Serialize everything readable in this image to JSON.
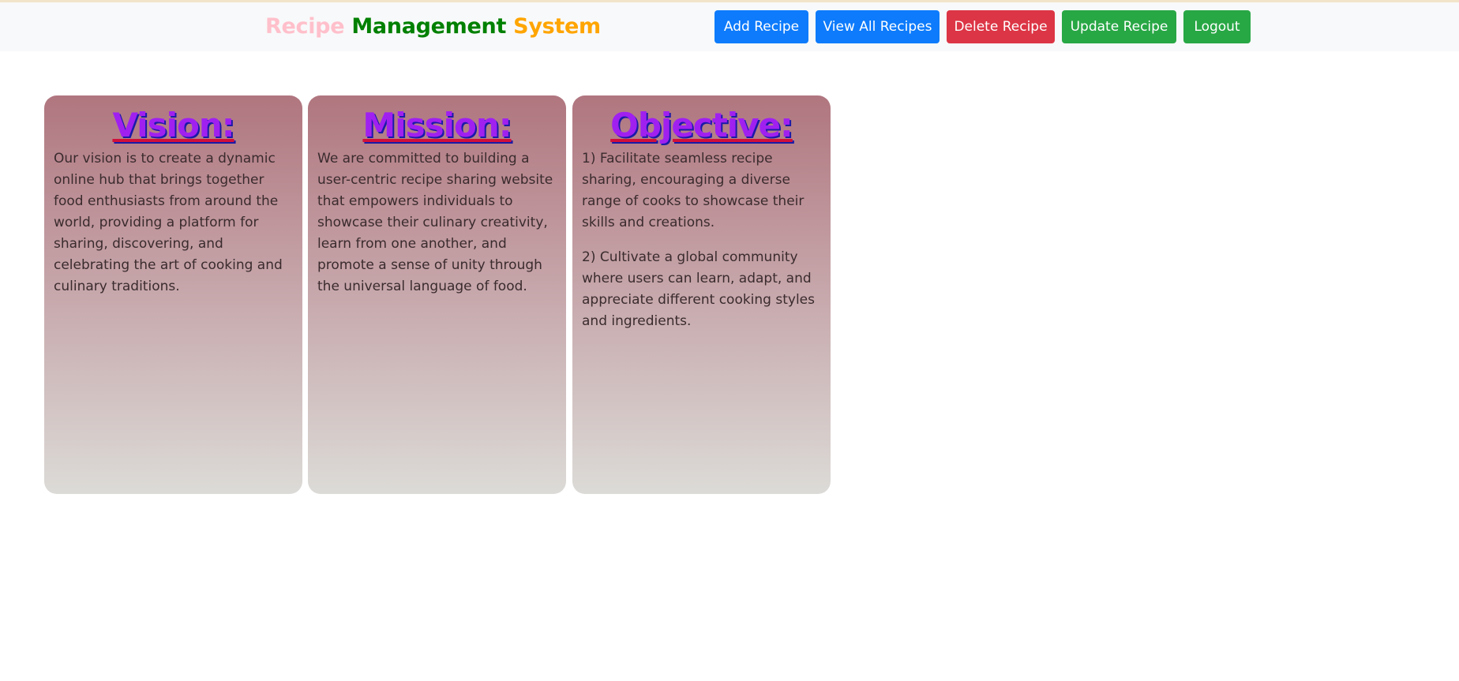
{
  "header": {
    "brand": {
      "word1": "Recipe",
      "word2": "Management",
      "word3": "System"
    },
    "buttons": {
      "add_recipe": "Add Recipe",
      "view_all_recipes": "View All Recipes",
      "delete_recipe": "Delete Recipe",
      "update_recipe": "Update Recipe",
      "logout": "Logout"
    }
  },
  "cards": {
    "vision": {
      "title": "Vision:",
      "text": "Our vision is to create a dynamic online hub that brings together food enthusiasts from around the world, providing a platform for sharing, discovering, and celebrating the art of cooking and culinary traditions."
    },
    "mission": {
      "title": "Mission:",
      "text": "We are committed to building a user-centric recipe sharing website that empowers individuals to showcase their culinary creativity, learn from one another, and promote a sense of unity through the universal language of food."
    },
    "objective": {
      "title": "Objective:",
      "items": [
        "1) Facilitate seamless recipe sharing, encouraging a diverse range of cooks to showcase their skills and creations.",
        "2) Cultivate a global community where users can learn, adapt, and appreciate different cooking styles and ingredients."
      ]
    }
  },
  "colors": {
    "brand_word1": "#ffc0cb",
    "brand_word2": "#008000",
    "brand_word3": "#ffa500",
    "button_primary": "#0d7bfb",
    "button_danger": "#dc3545",
    "button_success": "#28a745",
    "card_title": "#a020f0"
  }
}
